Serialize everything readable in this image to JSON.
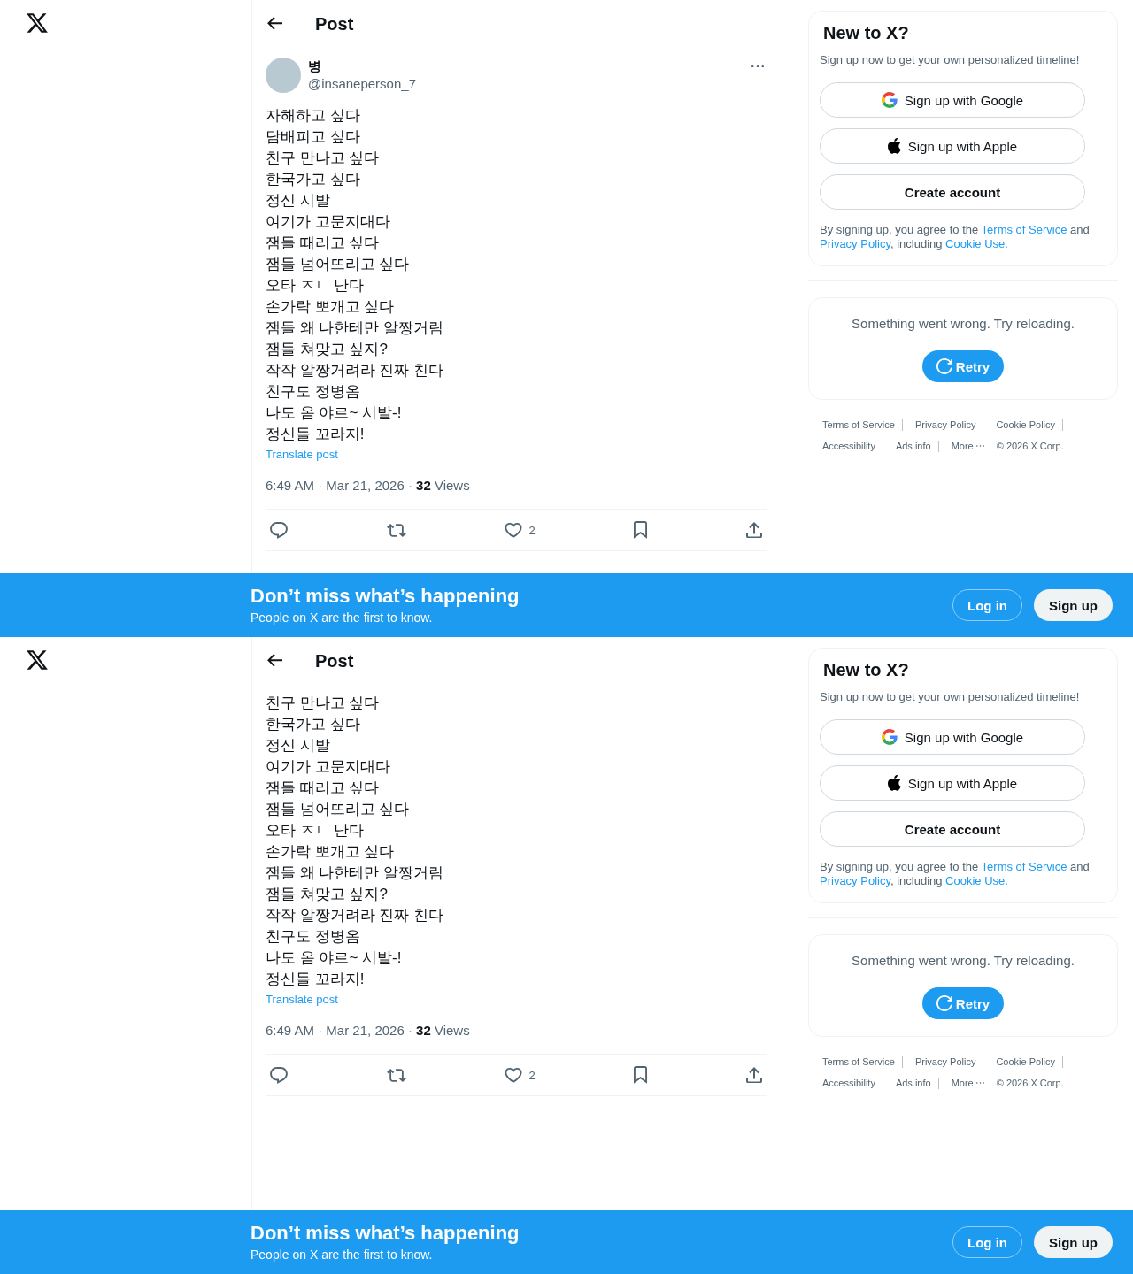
{
  "frames": [
    {
      "header": {
        "title": "Post"
      },
      "post": {
        "author": {
          "name": "병",
          "handle": "@insaneperson_7"
        },
        "lines": [
          "자해하고 싶다",
          "담배피고 싶다",
          "친구 만나고 싶다",
          "한국가고 싶다",
          "정신 시발",
          "여기가 고문지대다",
          "잼들 때리고 싶다",
          "잼들 넘어뜨리고 싶다",
          "오타 ㅈㄴ 난다",
          "손가락 뽀개고 싶다",
          "잼들 왜 나한테만 알짱거림",
          "잼들 쳐맞고 싶지?",
          "작작 알짱거려라 진짜 친다",
          "친구도 정병옴",
          "나도 옴 야르~ 시발-!",
          "정신들 꼬라지!"
        ],
        "translate": "Translate post",
        "meta": "6:49 AM · Mar 21, 2026 · **32** Views",
        "actions": [
          {
            "kind": "reply"
          },
          {
            "kind": "repost"
          },
          {
            "kind": "like",
            "count": "2"
          },
          {
            "kind": "bookmark"
          },
          {
            "kind": "share"
          }
        ]
      },
      "signup_card": {
        "title": "New to X?",
        "subtitle": "Sign up now to get your own personalized timeline!",
        "buttons": [
          {
            "kind": "google",
            "label": "Sign up with Google"
          },
          {
            "kind": "apple",
            "label": "Sign up with Apple"
          },
          {
            "kind": "create",
            "label": "Create account"
          }
        ],
        "legal": [
          {
            "kind": "text",
            "text": "By signing up, you agree to the "
          },
          {
            "kind": "link",
            "text": "Terms of Service"
          },
          {
            "kind": "text",
            "text": " and "
          },
          {
            "kind": "link",
            "text": "Privacy Policy"
          },
          {
            "kind": "text",
            "text": ", including "
          },
          {
            "kind": "link",
            "text": "Cookie Use."
          }
        ]
      },
      "error_card": {
        "message": "Something went wrong. Try reloading.",
        "retry": "Retry"
      },
      "footer": [
        {
          "kind": "link",
          "text": "Terms of Service"
        },
        {
          "kind": "link",
          "text": "Privacy Policy"
        },
        {
          "kind": "link",
          "text": "Cookie Policy"
        },
        {
          "kind": "link",
          "text": "Accessibility"
        },
        {
          "kind": "link",
          "text": "Ads info"
        },
        {
          "kind": "more",
          "text": "More"
        },
        {
          "kind": "copyright",
          "text": "© 2026 X Corp."
        }
      ],
      "banner": {
        "title": "Don’t miss what’s happening",
        "subtitle": "People on X are the first to know.",
        "login": "Log in",
        "signup": "Sign up"
      }
    },
    {
      "header": {
        "title": "Post"
      },
      "post": {
        "lines": [
          "친구 만나고 싶다",
          "한국가고 싶다",
          "정신 시발",
          "여기가 고문지대다",
          "잼들 때리고 싶다",
          "잼들 넘어뜨리고 싶다",
          "오타 ㅈㄴ 난다",
          "손가락 뽀개고 싶다",
          "잼들 왜 나한테만 알짱거림",
          "잼들 쳐맞고 싶지?",
          "작작 알짱거려라 진짜 친다",
          "친구도 정병옴",
          "나도 옴 야르~ 시발-!",
          "정신들 꼬라지!"
        ],
        "translate": "Translate post",
        "meta": "6:49 AM · Mar 21, 2026 · **32** Views",
        "actions": [
          {
            "kind": "reply"
          },
          {
            "kind": "repost"
          },
          {
            "kind": "like",
            "count": "2"
          },
          {
            "kind": "bookmark"
          },
          {
            "kind": "share"
          }
        ]
      },
      "signup_card": {
        "title": "New to X?",
        "subtitle": "Sign up now to get your own personalized timeline!",
        "buttons": [
          {
            "kind": "google",
            "label": "Sign up with Google"
          },
          {
            "kind": "apple",
            "label": "Sign up with Apple"
          },
          {
            "kind": "create",
            "label": "Create account"
          }
        ],
        "legal": [
          {
            "kind": "text",
            "text": "By signing up, you agree to the "
          },
          {
            "kind": "link",
            "text": "Terms of Service"
          },
          {
            "kind": "text",
            "text": " and "
          },
          {
            "kind": "link",
            "text": "Privacy Policy"
          },
          {
            "kind": "text",
            "text": ", including "
          },
          {
            "kind": "link",
            "text": "Cookie Use."
          }
        ]
      },
      "error_card": {
        "message": "Something went wrong. Try reloading.",
        "retry": "Retry"
      },
      "footer": [
        {
          "kind": "link",
          "text": "Terms of Service"
        },
        {
          "kind": "link",
          "text": "Privacy Policy"
        },
        {
          "kind": "link",
          "text": "Cookie Policy"
        },
        {
          "kind": "link",
          "text": "Accessibility"
        },
        {
          "kind": "link",
          "text": "Ads info"
        },
        {
          "kind": "more",
          "text": "More"
        },
        {
          "kind": "copyright",
          "text": "© 2026 X Corp."
        }
      ],
      "banner": {
        "title": "Don’t miss what’s happening",
        "subtitle": "People on X are the first to know.",
        "login": "Log in",
        "signup": "Sign up"
      }
    }
  ]
}
